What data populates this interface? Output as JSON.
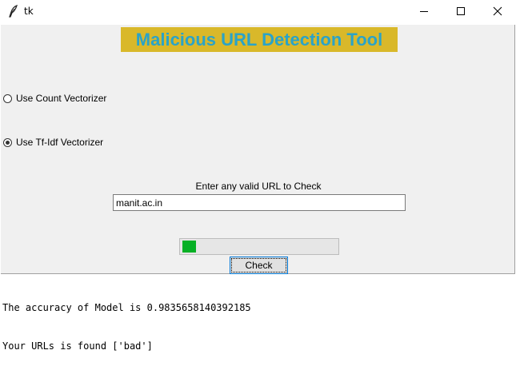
{
  "window": {
    "title": "tk",
    "icon": "tk-feather-icon",
    "controls": [
      "minimize-icon",
      "maximize-icon",
      "close-icon"
    ]
  },
  "app": {
    "title": "Malicious URL Detection Tool",
    "title_color": "#2aa3c8",
    "title_bg": "#d9b82a"
  },
  "options": {
    "count_label": "Use Count Vectorizer",
    "count_selected": false,
    "tfidf_label": "Use Tf-Idf Vectorizer",
    "tfidf_selected": true
  },
  "form": {
    "prompt": "Enter any valid URL to Check",
    "url_value": "manit.ac.in",
    "check_label": "Check"
  },
  "progress": {
    "fraction": 0.09,
    "fill_color": "#06b025"
  },
  "output": {
    "lines": [
      "The accuracy of Model is 0.9835658140392185",
      "Your URLs is found ['bad']"
    ]
  }
}
